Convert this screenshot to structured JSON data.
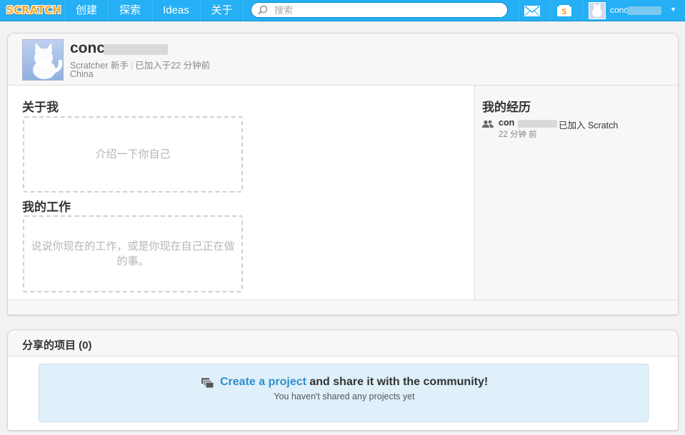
{
  "nav": {
    "logo": "SCRATCH",
    "create": "创建",
    "explore": "探索",
    "ideas": "Ideas",
    "about": "关于",
    "search_placeholder": "搜索",
    "account_name": "conc"
  },
  "profile": {
    "username": "conc",
    "rank": "Scratcher 新手",
    "joined": "已加入于22 分钟前",
    "country": "China"
  },
  "about_me": {
    "title": "关于我",
    "placeholder": "介绍一下你自己"
  },
  "working_on": {
    "title": "我的工作",
    "placeholder": "说说你现在的工作，或是你现在自己正在做的事。"
  },
  "history": {
    "title": "我的经历",
    "user": "con",
    "action": "已加入 Scratch",
    "time": "22 分钟 前"
  },
  "shared": {
    "title": "分享的项目 (0)",
    "cta_link": "Create a project",
    "cta_rest": " and share it with the community!",
    "sub": "You haven't shared any projects yet"
  },
  "colors": {
    "nav_blue": "#25aff4",
    "link_blue": "#2e8fcc",
    "panel_blue": "#dff0fb"
  }
}
